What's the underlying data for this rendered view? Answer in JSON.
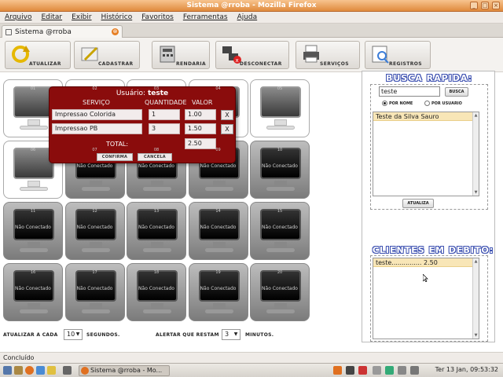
{
  "window": {
    "title": "Sistema @rroba - Mozilla Firefox",
    "buttons": [
      "_",
      "□",
      "×"
    ]
  },
  "menu": [
    "Arquivo",
    "Editar",
    "Exibir",
    "Histórico",
    "Favoritos",
    "Ferramentas",
    "Ajuda"
  ],
  "tab": {
    "title": "Sistema @rroba",
    "close": "⊗"
  },
  "toolbar": [
    {
      "key": "atualizar",
      "label": "ATUALIZAR",
      "icon": "refresh-icon"
    },
    {
      "key": "cadastrar",
      "label": "CADASTRAR",
      "icon": "pencil-icon"
    },
    {
      "key": "rendaria",
      "label": "RENDARIA",
      "icon": "calculator-icon"
    },
    {
      "key": "desconectar",
      "label": "DESCONECTAR",
      "icon": "disconnect-icon"
    },
    {
      "key": "servicos",
      "label": "SERVIÇOS",
      "icon": "printer-icon"
    },
    {
      "key": "registros",
      "label": "REGISTROS",
      "icon": "report-icon"
    }
  ],
  "computers": [
    {
      "num": "01",
      "status": "",
      "free": true
    },
    {
      "num": "02",
      "status": "",
      "free": true
    },
    {
      "num": "03",
      "status": "",
      "free": true
    },
    {
      "num": "04",
      "status": "",
      "free": true
    },
    {
      "num": "05",
      "status": "",
      "free": true
    },
    {
      "num": "06",
      "status": "",
      "free": true
    },
    {
      "num": "07",
      "status": "Não Conectado",
      "free": false
    },
    {
      "num": "08",
      "status": "Não Conectado",
      "free": false
    },
    {
      "num": "09",
      "status": "Não Conectado",
      "free": false
    },
    {
      "num": "10",
      "status": "Não Conectado",
      "free": false
    },
    {
      "num": "11",
      "status": "Não Conectado",
      "free": false
    },
    {
      "num": "12",
      "status": "Não Conectado",
      "free": false
    },
    {
      "num": "13",
      "status": "Não Conectado",
      "free": false
    },
    {
      "num": "14",
      "status": "Não Conectado",
      "free": false
    },
    {
      "num": "15",
      "status": "Não Conectado",
      "free": false
    },
    {
      "num": "16",
      "status": "Não Conectado",
      "free": false
    },
    {
      "num": "17",
      "status": "Não Conectado",
      "free": false
    },
    {
      "num": "18",
      "status": "Não Conectado",
      "free": false
    },
    {
      "num": "19",
      "status": "Não Conectado",
      "free": false
    },
    {
      "num": "20",
      "status": "Não Conectado",
      "free": false
    }
  ],
  "bottom": {
    "atualizar_label": "ATUALIZAR A CADA",
    "atualizar_value": "10",
    "atualizar_unit": "SEGUNDOS.",
    "alertar_label": "ALERTAR QUE RESTAM",
    "alertar_value": "3",
    "alertar_unit": "MINUTOS."
  },
  "busca": {
    "title": "BUSCA RAPIDA:",
    "query": "teste",
    "button": "BUSCA",
    "radio_nome": "POR NOME",
    "radio_usuario": "POR USUARIO",
    "results": [
      "Teste da Silva Sauro"
    ],
    "atualiza": "ATUALIZA"
  },
  "debito": {
    "title": "CLIENTES EM DEBITO:",
    "items": [
      "teste............... 2.50"
    ]
  },
  "modal": {
    "usuario_label": "Usuário:",
    "usuario": "teste",
    "col_servico": "SERVIÇO",
    "col_quantidade": "QUANTIDADE",
    "col_valor": "VALOR",
    "rows": [
      {
        "servico": "Impressao Colorida",
        "quantidade": "1",
        "valor": "1.00",
        "remove": "X"
      },
      {
        "servico": "Impressao PB",
        "quantidade": "3",
        "valor": "1.50",
        "remove": "X"
      }
    ],
    "total_label": "TOTAL:",
    "total": "2.50",
    "confirma": "CONFIRMA",
    "cancela": "CANCELA"
  },
  "status": "Concluído",
  "taskbar": {
    "task": "Sistema @rroba - Mo...",
    "clock": "Ter 13 Jan, 09:53:32"
  },
  "colors": {
    "modal_bg": "#8a0c0c",
    "title_blue": "#3b4fb0",
    "window_orange": "#e08a3c",
    "highlight": "#f8e6b7"
  }
}
